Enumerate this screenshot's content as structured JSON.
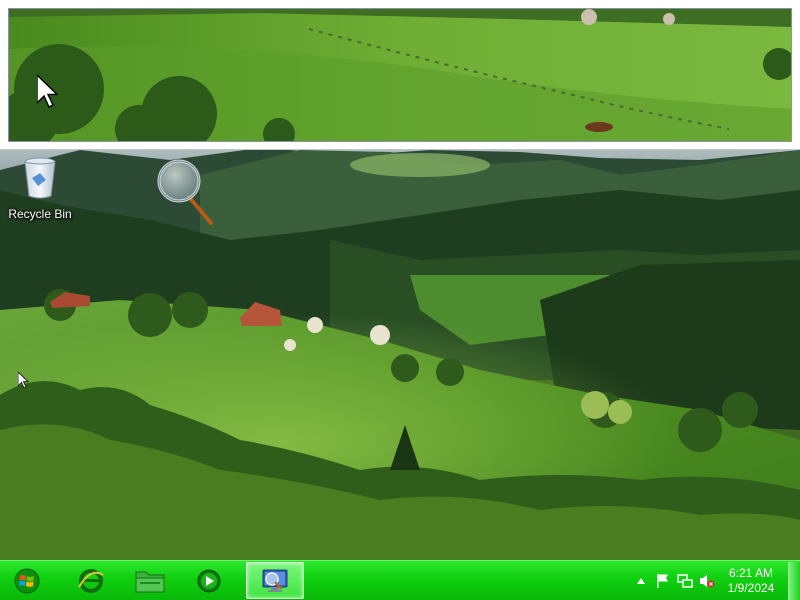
{
  "desktop": {
    "icons": [
      {
        "label": "Recycle Bin",
        "icon": "recycle-bin-icon"
      }
    ]
  },
  "magnifier": {
    "icon": "magnifier-icon"
  },
  "taskbar": {
    "start_icon": "windows-logo-icon",
    "pinned": [
      {
        "name": "internet-explorer",
        "icon": "internet-explorer-icon"
      },
      {
        "name": "file-explorer",
        "icon": "folder-icon"
      },
      {
        "name": "media-player",
        "icon": "media-player-icon"
      },
      {
        "name": "magnifier",
        "icon": "magnifier-app-icon",
        "active": true
      }
    ],
    "tray": {
      "icons": [
        "show-hidden-icons-arrow",
        "action-center-flag-icon",
        "network-icon",
        "volume-muted-icon"
      ],
      "time": "6:21 AM",
      "date": "1/9/2024"
    },
    "accent": "#12c912"
  }
}
